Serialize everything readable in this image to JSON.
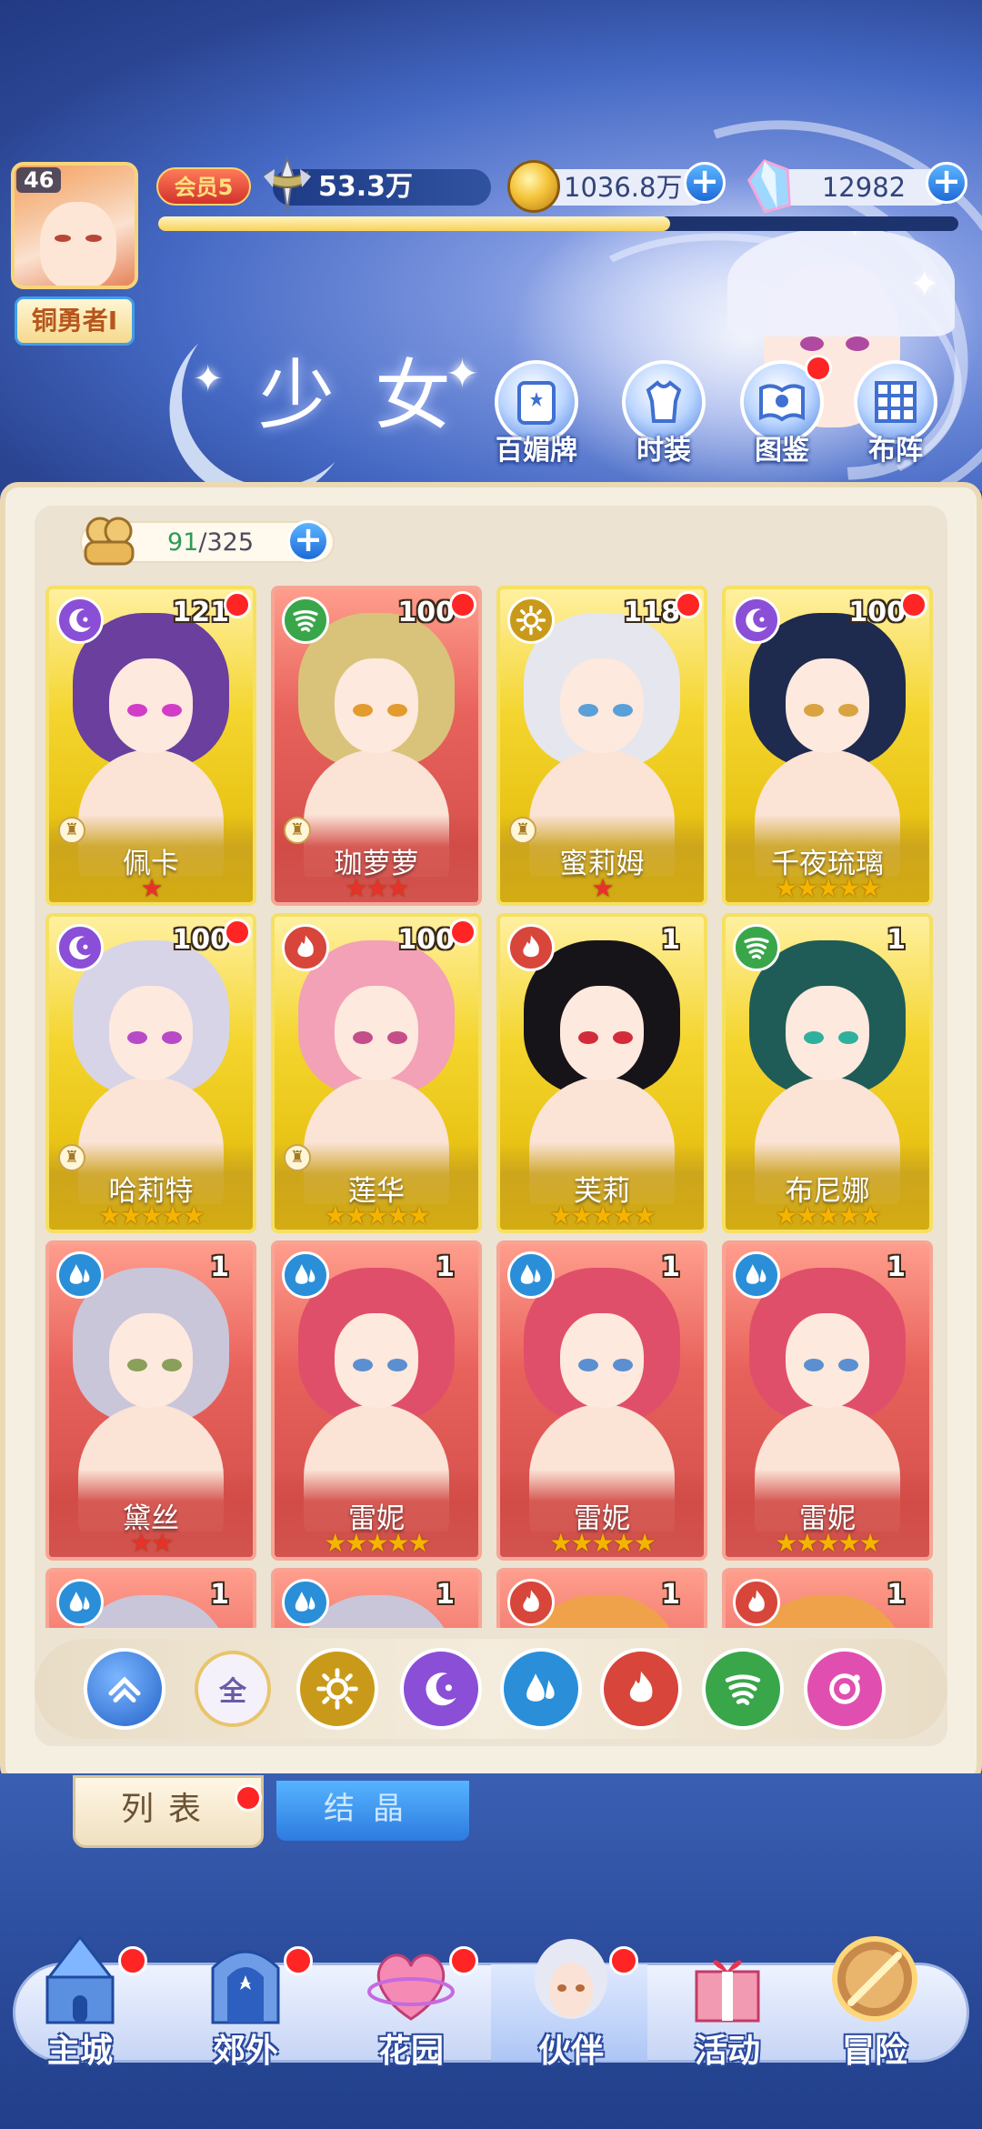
{
  "header": {
    "player_level": "46",
    "rank_title": "铜勇者I",
    "vip_label": "会员5",
    "power": "53.3万",
    "gold": "1036.8万",
    "gems": "12982",
    "xp_progress": 0.64,
    "page_title": "少女",
    "buttons": [
      {
        "label": "百媚牌",
        "icon": "card-deck-icon",
        "badge": false
      },
      {
        "label": "时装",
        "icon": "outfit-icon",
        "badge": false
      },
      {
        "label": "图鉴",
        "icon": "codex-book-icon",
        "badge": true
      },
      {
        "label": "布阵",
        "icon": "formation-grid-icon",
        "badge": false
      }
    ]
  },
  "roster": {
    "count_current": "91",
    "count_sep": "/325",
    "cards": [
      {
        "name": "佩卡",
        "level": "121",
        "element": "moon",
        "frame": "gold",
        "stars": 1,
        "badge": true,
        "hair": "#6a3f9e",
        "eyes": "#d23cc8",
        "rank_icon": true
      },
      {
        "name": "珈萝萝",
        "level": "100",
        "element": "wind",
        "frame": "red",
        "stars": 3,
        "badge": true,
        "hair": "#d9c37a",
        "eyes": "#e39b2e",
        "rank_icon": true
      },
      {
        "name": "蜜莉姆",
        "level": "118",
        "element": "sun",
        "frame": "gold",
        "stars": 1,
        "badge": true,
        "hair": "#e6e6ee",
        "eyes": "#5aa0d8",
        "rank_icon": true
      },
      {
        "name": "千夜琉璃",
        "level": "100",
        "element": "moon",
        "frame": "gold",
        "stars": 5,
        "badge": true,
        "hair": "#1e2a4e",
        "eyes": "#d9a341",
        "rank_icon": false
      },
      {
        "name": "哈莉特",
        "level": "100",
        "element": "moon",
        "frame": "gold",
        "stars": 5,
        "badge": true,
        "hair": "#d7d4e8",
        "eyes": "#b84ac8",
        "rank_icon": true
      },
      {
        "name": "莲华",
        "level": "100",
        "element": "fire",
        "frame": "gold",
        "stars": 5,
        "badge": true,
        "hair": "#f2a1b6",
        "eyes": "#c44e8a",
        "rank_icon": true
      },
      {
        "name": "芙莉",
        "level": "1",
        "element": "fire",
        "frame": "gold",
        "stars": 5,
        "badge": false,
        "hair": "#171419",
        "eyes": "#d22c3a",
        "rank_icon": false
      },
      {
        "name": "布尼娜",
        "level": "1",
        "element": "wind",
        "frame": "gold",
        "stars": 5,
        "badge": false,
        "hair": "#1f5c58",
        "eyes": "#2fb09e",
        "rank_icon": false
      },
      {
        "name": "黛丝",
        "level": "1",
        "element": "water",
        "frame": "red",
        "stars": 2,
        "badge": false,
        "hair": "#c9c6da",
        "eyes": "#8aa05a",
        "rank_icon": false
      },
      {
        "name": "雷妮",
        "level": "1",
        "element": "water",
        "frame": "red",
        "stars": 5,
        "badge": false,
        "hair": "#e04f6a",
        "eyes": "#5b8fd0",
        "rank_icon": false
      },
      {
        "name": "雷妮",
        "level": "1",
        "element": "water",
        "frame": "red",
        "stars": 5,
        "badge": false,
        "hair": "#e04f6a",
        "eyes": "#5b8fd0",
        "rank_icon": false
      },
      {
        "name": "雷妮",
        "level": "1",
        "element": "water",
        "frame": "red",
        "stars": 5,
        "badge": false,
        "hair": "#e04f6a",
        "eyes": "#5b8fd0",
        "rank_icon": false
      },
      {
        "name": "",
        "level": "1",
        "element": "water",
        "frame": "red",
        "stars": 0,
        "badge": false,
        "hair": "#c9c6da",
        "eyes": "#8aa05a",
        "rank_icon": false
      },
      {
        "name": "",
        "level": "1",
        "element": "water",
        "frame": "red",
        "stars": 0,
        "badge": false,
        "hair": "#c9c6da",
        "eyes": "#8aa05a",
        "rank_icon": false
      },
      {
        "name": "",
        "level": "1",
        "element": "fire",
        "frame": "red",
        "stars": 0,
        "badge": false,
        "hair": "#f0a24a",
        "eyes": "#4a7fc8",
        "rank_icon": false
      },
      {
        "name": "",
        "level": "1",
        "element": "fire",
        "frame": "red",
        "stars": 0,
        "badge": false,
        "hair": "#f0a24a",
        "eyes": "#4a7fc8",
        "rank_icon": false
      }
    ]
  },
  "filters": [
    {
      "id": "collapse",
      "icon": "chevron-up-icon",
      "label": ""
    },
    {
      "id": "all",
      "icon": "all-icon",
      "label": "全"
    },
    {
      "id": "sun",
      "icon": "sun-element-icon",
      "label": ""
    },
    {
      "id": "moon",
      "icon": "moon-element-icon",
      "label": ""
    },
    {
      "id": "water",
      "icon": "water-element-icon",
      "label": ""
    },
    {
      "id": "fire",
      "icon": "fire-element-icon",
      "label": ""
    },
    {
      "id": "wind",
      "icon": "wind-element-icon",
      "label": ""
    },
    {
      "id": "arcane",
      "icon": "arcane-element-icon",
      "label": ""
    }
  ],
  "subtabs": {
    "list": "列表",
    "crystal": "结晶"
  },
  "nav": [
    {
      "label": "主城",
      "icon": "castle-icon",
      "badge": true
    },
    {
      "label": "郊外",
      "icon": "gate-icon",
      "badge": true
    },
    {
      "label": "花园",
      "icon": "heart-garden-icon",
      "badge": true
    },
    {
      "label": "伙伴",
      "icon": "partner-portrait-icon",
      "badge": true
    },
    {
      "label": "活动",
      "icon": "gift-box-icon",
      "badge": false
    },
    {
      "label": "冒险",
      "icon": "compass-icon",
      "badge": false
    }
  ],
  "colors": {
    "element_moon": "#8a4fd6",
    "element_wind": "#3aa64a",
    "element_sun": "#c99a1a",
    "element_fire": "#d8453a",
    "element_water": "#2a8fd8",
    "element_arcane": "#e04fb0",
    "star": "#f5b400"
  }
}
